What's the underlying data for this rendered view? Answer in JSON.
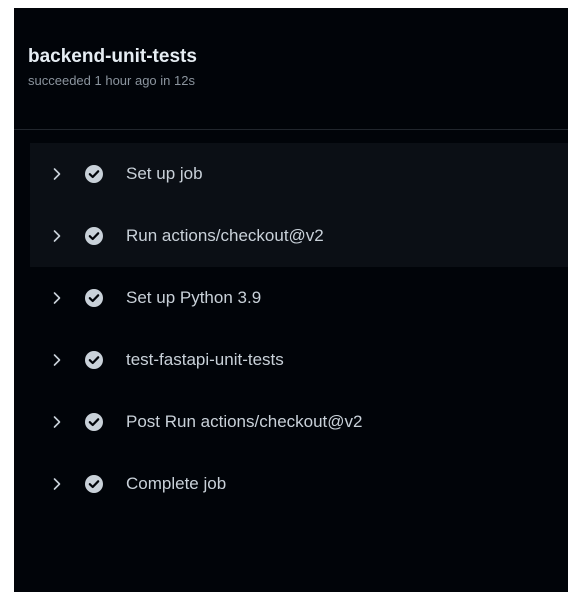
{
  "job": {
    "title": "backend-unit-tests",
    "status": "succeeded 1 hour ago in 12s"
  },
  "steps": [
    {
      "label": "Set up job",
      "icon": "check-circle-icon"
    },
    {
      "label": "Run actions/checkout@v2",
      "icon": "check-circle-icon"
    },
    {
      "label": "Set up Python 3.9",
      "icon": "check-circle-icon"
    },
    {
      "label": "test-fastapi-unit-tests",
      "icon": "check-circle-icon"
    },
    {
      "label": "Post Run actions/checkout@v2",
      "icon": "check-circle-icon"
    },
    {
      "label": "Complete job",
      "icon": "check-circle-icon"
    }
  ],
  "colors": {
    "background": "#010409",
    "title": "#e6edf3",
    "muted": "#8b949e",
    "check": "#8b949e"
  }
}
